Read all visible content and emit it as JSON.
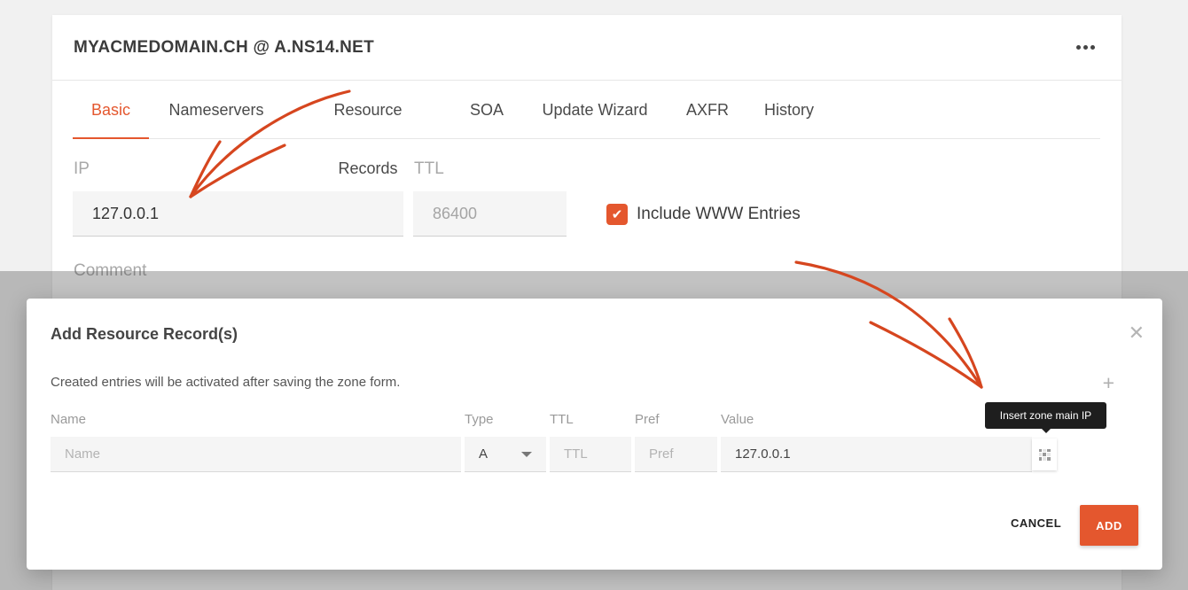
{
  "page": {
    "title": "MYACMEDOMAIN.CH @ A.NS14.NET"
  },
  "tabs": [
    {
      "label": "Basic",
      "active": true
    },
    {
      "label": "Nameservers"
    },
    {
      "label": "Resource Records"
    },
    {
      "label": "SOA"
    },
    {
      "label": "Update Wizard"
    },
    {
      "label": "AXFR"
    },
    {
      "label": "History"
    }
  ],
  "basic": {
    "ip_label": "IP",
    "ip_value": "127.0.0.1",
    "ttl_label": "TTL",
    "ttl_placeholder": "86400",
    "include_www_label": "Include WWW Entries",
    "include_www_checked": true,
    "comment_label": "Comment"
  },
  "modal": {
    "title": "Add Resource Record(s)",
    "info": "Created entries will be activated after saving the zone form.",
    "columns": {
      "name": "Name",
      "type": "Type",
      "ttl": "TTL",
      "pref": "Pref",
      "value": "Value"
    },
    "row": {
      "name_placeholder": "Name",
      "type_value": "A",
      "ttl_placeholder": "TTL",
      "pref_placeholder": "Pref",
      "value": "127.0.0.1"
    },
    "tooltip": "Insert zone main IP",
    "cancel_label": "CANCEL",
    "add_label": "ADD"
  },
  "icons": {
    "more": "more-horizontal-icon",
    "close": "close-icon",
    "plus": "plus-icon",
    "check": "checkmark-icon",
    "caret": "chevron-down-icon",
    "insert_ip": "qr-code-icon"
  },
  "colors": {
    "accent": "#e4572e",
    "annotation_arrow": "#d6461f",
    "tooltip_bg": "#1e1e1e"
  }
}
